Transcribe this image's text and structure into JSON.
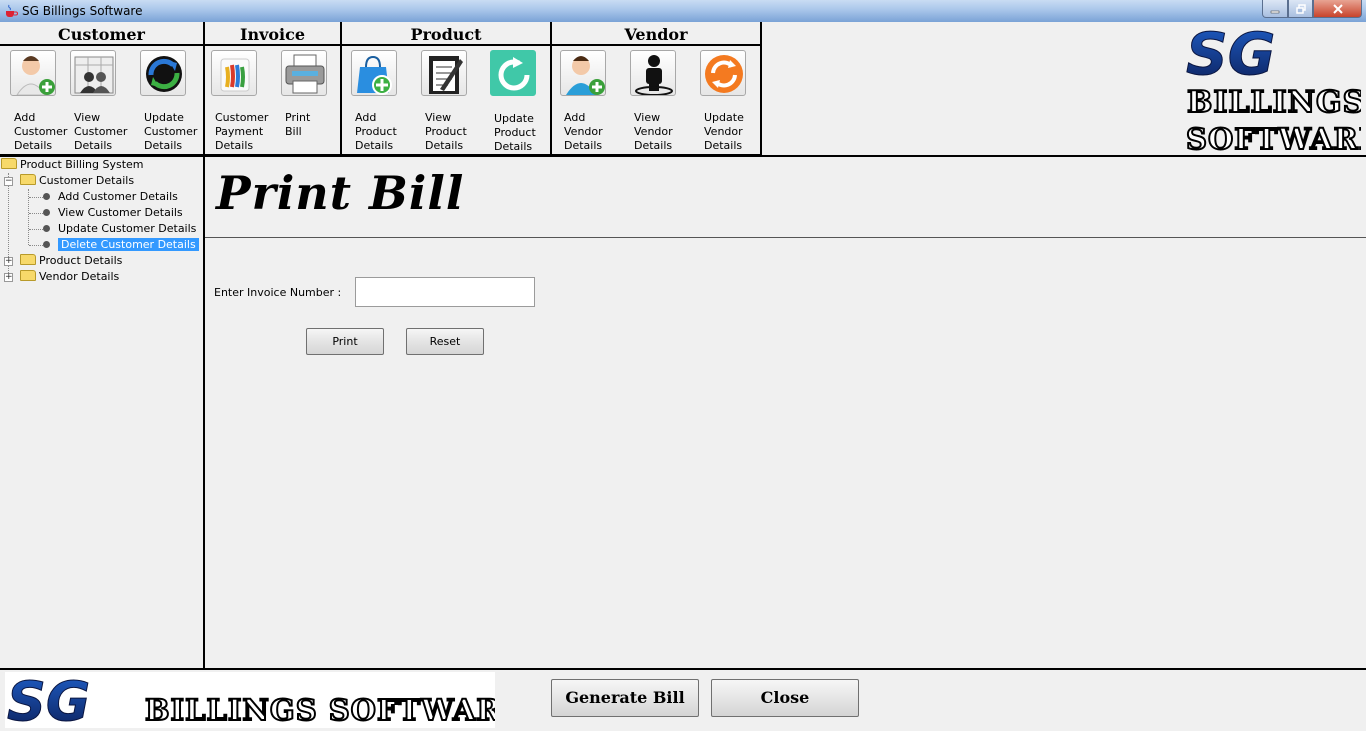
{
  "window": {
    "title": "SG Billings Software"
  },
  "toolbar": {
    "groups": [
      {
        "title": "Customer",
        "tools": [
          {
            "label": "Add\nCustomer\nDetails",
            "icon": "add-user-icon"
          },
          {
            "label": "View\nCustomer\nDetails",
            "icon": "contacts-icon"
          },
          {
            "label": "Update\nCustomer\nDetails",
            "icon": "sync-icon"
          }
        ]
      },
      {
        "title": "Invoice",
        "tools": [
          {
            "label": "Customer\nPayment\nDetails",
            "icon": "wallet-icon"
          },
          {
            "label": "Print\nBill",
            "icon": "printer-icon"
          }
        ]
      },
      {
        "title": "Product",
        "tools": [
          {
            "label": "Add\nProduct\nDetails",
            "icon": "add-bag-icon"
          },
          {
            "label": "View\nProduct\nDetails",
            "icon": "clipboard-icon"
          },
          {
            "label": "Update\nProduct\nDetails",
            "icon": "refresh-icon"
          }
        ]
      },
      {
        "title": "Vendor",
        "tools": [
          {
            "label": "Add\nVendor\nDetails",
            "icon": "add-user-icon"
          },
          {
            "label": "View\nVendor\nDetails",
            "icon": "person-pin-icon"
          },
          {
            "label": "Update\nVendor\nDetails",
            "icon": "refresh-icon"
          }
        ]
      }
    ]
  },
  "logo": {
    "mark": "SG",
    "line1": "BILLINGS",
    "line2": "SOFTWARE",
    "wide": "BILLINGS SOFTWARE"
  },
  "tree": {
    "root": "Product Billing System",
    "customer": "Customer Details",
    "customer_items": [
      "Add Customer Details",
      "View Customer Details",
      "Update Customer Details",
      "Delete Customer Details"
    ],
    "product": "Product Details",
    "vendor": "Vendor Details"
  },
  "main": {
    "title": "Print Bill",
    "invoice_label": "Enter Invoice Number :",
    "invoice_value": "",
    "print_label": "Print",
    "reset_label": "Reset"
  },
  "footer": {
    "generate_label": "Generate Bill",
    "close_label": "Close"
  },
  "colors": {
    "selection": "#3399ff",
    "logo_blue": "#1c3c8c"
  }
}
